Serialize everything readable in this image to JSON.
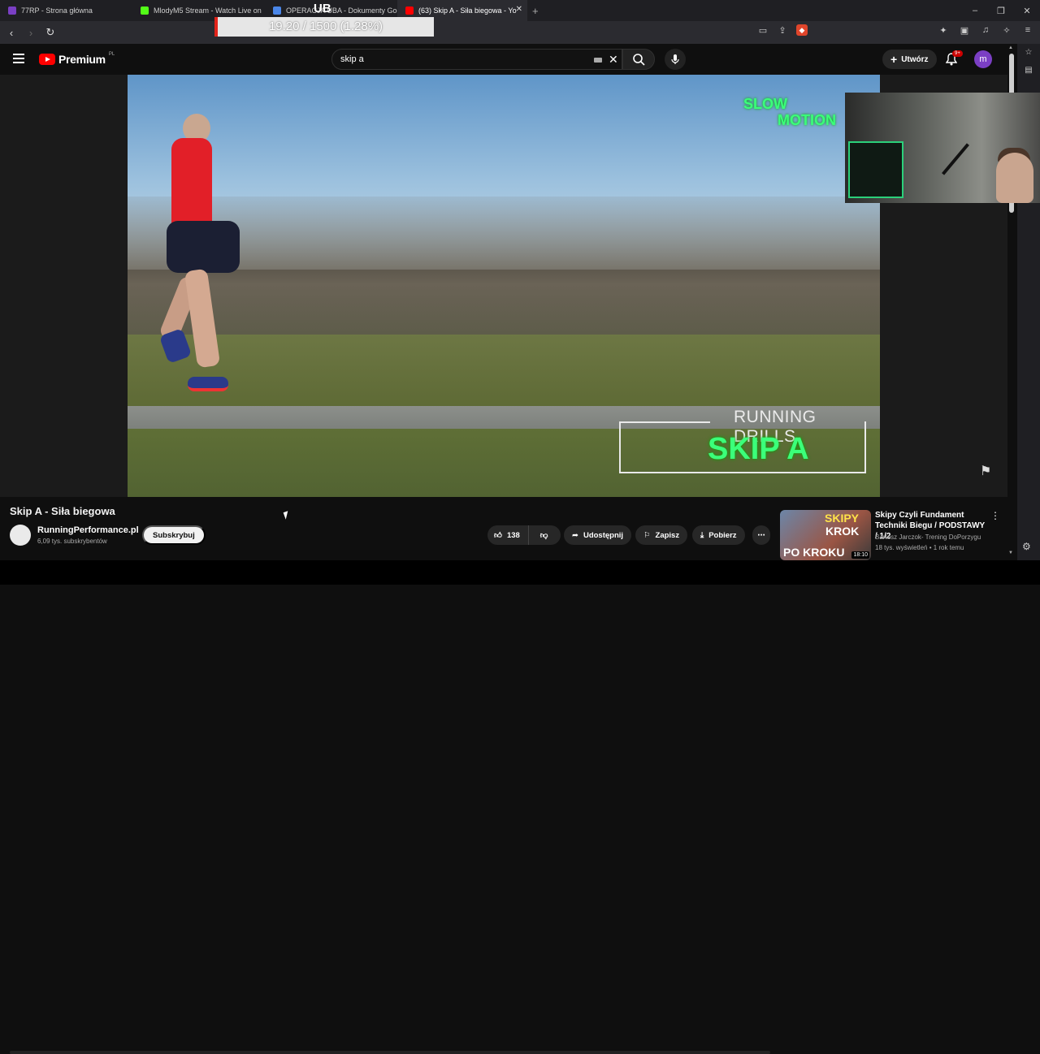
{
  "browser": {
    "tabs": [
      {
        "title": "77RP - Strona główna",
        "color": "#7a3fc4"
      },
      {
        "title": "MlodyM5 Stream - Watch Live on",
        "color": "#53fc18"
      },
      {
        "title": "OPERACJA UBA - Dokumenty Goog",
        "color": "#4a86e8"
      },
      {
        "title": "(63) Skip A - Siła biegowa - Yo",
        "color": "#ff0000"
      }
    ],
    "new_tab": "+",
    "overlay_title": "UB",
    "overlay_progress": "19.20 / 1500 (1.28%)"
  },
  "youtube": {
    "logo_text": "Premium",
    "logo_region": "PL",
    "search_value": "skip a",
    "create_label": "Utwórz",
    "notifications": "9+",
    "avatar_letter": "m"
  },
  "video": {
    "overlay_slow": "SLOW",
    "overlay_motion": "MOTION",
    "drills_title": "RUNNING DRILLS",
    "drills_skip": "SKIP A",
    "title": "Skip A - Siła biegowa",
    "channel": "RunningPerformance.pl",
    "subscribers": "6,09 tys. subskrybentów",
    "subscribe": "Subskrybuj",
    "likes": "138",
    "share": "Udostępnij",
    "save": "Zapisz",
    "download": "Pobierz"
  },
  "recommended": {
    "title": "Skipy Czyli Fundament Techniki Biegu / PODSTAWY / 1/2",
    "channel": "Bartosz Jarczok- Trening DoPorzygu",
    "meta": "18 tys. wyświetleń • 1 rok temu",
    "thumb_line1": "SKIPY",
    "thumb_line2": "KROK",
    "thumb_line3": "PO KROKU",
    "duration": "18:10"
  }
}
